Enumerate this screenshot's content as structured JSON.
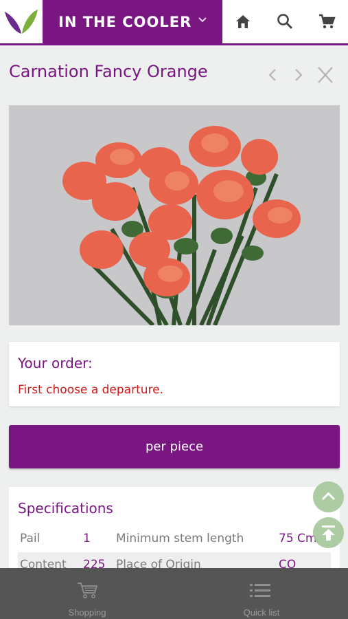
{
  "header": {
    "title": "IN THE COOLER",
    "icons": [
      "logo-leaf-icon",
      "chevron-down-icon",
      "home-icon",
      "search-icon",
      "cart-icon"
    ]
  },
  "product": {
    "name": "Carnation Fancy Orange",
    "image_alt": "Orange carnation bouquet"
  },
  "order": {
    "label": "Your order:",
    "message": "First choose a departure."
  },
  "purchase_button": "per piece",
  "specifications": {
    "title": "Specifications",
    "rows": [
      {
        "k1": "Pail",
        "v1": "1",
        "k2": "Minimum stem length",
        "v2": "75 Cm"
      },
      {
        "k1": "Content",
        "v1": "225",
        "k2": "Place of Origin",
        "v2": "CO"
      }
    ]
  },
  "bottom_nav": {
    "items": [
      {
        "label": "Shopping",
        "icon": "shopping-cart-icon"
      },
      {
        "label": "Quick list",
        "icon": "list-icon"
      }
    ]
  },
  "colors": {
    "brand": "#7a1682",
    "error": "#d11a1a",
    "fab": "#a6c79a"
  }
}
